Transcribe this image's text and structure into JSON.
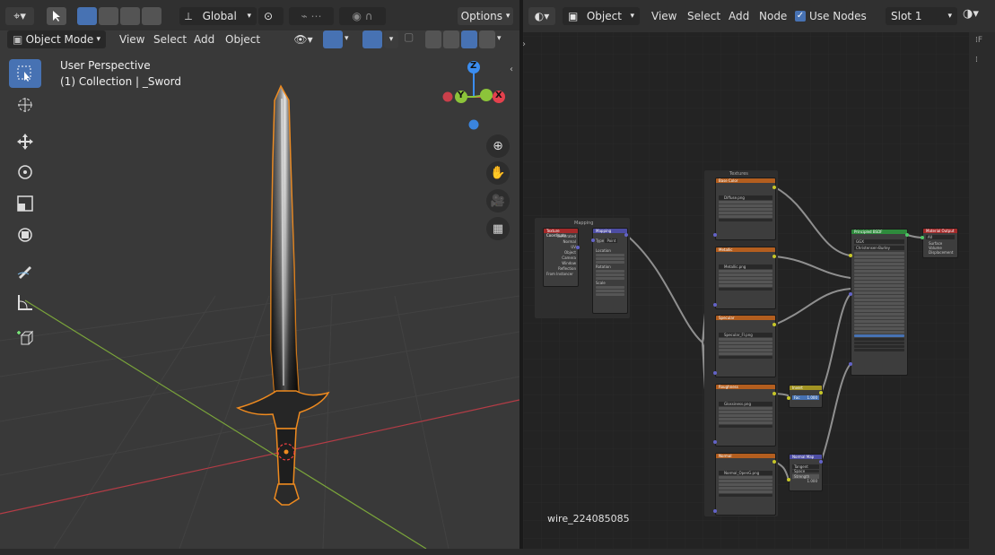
{
  "viewport": {
    "header": {
      "transform_orientation": "Global",
      "options_label": "Options",
      "mode": "Object Mode",
      "menus": [
        "View",
        "Select",
        "Add",
        "Object"
      ]
    },
    "overlay": {
      "perspective": "User Perspective",
      "collection": "(1) Collection | _Sword"
    },
    "gizmo": {
      "x": "X",
      "y": "Y",
      "z": "Z"
    },
    "colors": {
      "x_axis": "#e4414d",
      "y_axis": "#8cc43a",
      "z_axis": "#3b8df0",
      "selection": "#ee8a1f",
      "bg": "#393939"
    }
  },
  "node_editor": {
    "header": {
      "editor_type": "Object",
      "menus": [
        "View",
        "Select",
        "Add",
        "Node"
      ],
      "use_nodes_label": "Use Nodes",
      "use_nodes_checked": true,
      "slot": "Slot 1"
    },
    "material_name": "wire_224085085",
    "frames": {
      "textures": "Textures",
      "mapping": "Mapping"
    },
    "nodes": {
      "tex_coord": {
        "title": "Texture Coordinate",
        "outputs": [
          "Generated",
          "Normal",
          "UV",
          "Object",
          "Camera",
          "Window",
          "Reflection"
        ],
        "from_instancer": "From Instancer"
      },
      "mapping": {
        "title": "Mapping",
        "type_label": "Type",
        "type_value": "Point",
        "fields": [
          "Location",
          "Rotation",
          "Scale"
        ]
      },
      "base_color": {
        "title": "Base Color",
        "image": "Diffuse.png"
      },
      "metallic": {
        "title": "Metallic",
        "image": "Metallic.png"
      },
      "specular": {
        "title": "Specular",
        "image": "Specular_Fl.png"
      },
      "roughness": {
        "title": "Roughness",
        "image": "Glossiness.png"
      },
      "normal": {
        "title": "Normal",
        "image": "Normal_OpenG.png"
      },
      "invert": {
        "title": "Invert",
        "fac": "Fac",
        "fac_value": "1.000"
      },
      "normal_map": {
        "title": "Normal Map",
        "space": "Tangent Space",
        "strength": "Strength",
        "strength_value": "1.000"
      },
      "principled": {
        "title": "Principled BSDF",
        "distribution": "GGX",
        "subsurface_method": "Christensen-Burley"
      },
      "output": {
        "title": "Material Output",
        "target": "All",
        "inputs": [
          "Surface",
          "Volume",
          "Displacement"
        ]
      }
    },
    "colors": {
      "bg": "#232323",
      "grid": "#2c2c2c",
      "texture_header": "#b35e1f",
      "mapping_header": "#4d4da3",
      "coord_header": "#a32a2a",
      "shader_header": "#2e8a3c",
      "output_header": "#a32a2a",
      "converter_header": "#a19323",
      "vector_header": "#4d4da3",
      "link": "#8f8f8f"
    }
  }
}
